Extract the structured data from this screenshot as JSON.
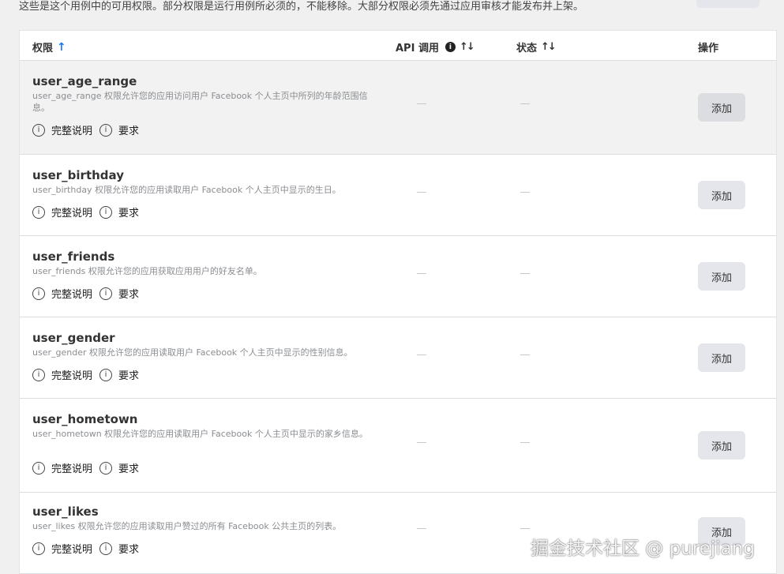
{
  "intro_text": "这些是这个用例中的可用权限。部分权限是运行用例所必须的，不能移除。大部分权限必须先通过应用审核才能发布并上架。",
  "header": {
    "permission": "权限",
    "api_calls": "API 调用",
    "status": "状态",
    "action": "操作"
  },
  "rows": [
    {
      "name": "user_age_range",
      "desc": "user_age_range 权限允许您的应用访问用户 Facebook 个人主页中所列的年龄范围信息。",
      "full_desc": "完整说明",
      "requirements": "要求",
      "api": "—",
      "status": "—",
      "button": "添加"
    },
    {
      "name": "user_birthday",
      "desc": "user_birthday 权限允许您的应用读取用户 Facebook 个人主页中显示的生日。",
      "full_desc": "完整说明",
      "requirements": "要求",
      "api": "—",
      "status": "—",
      "button": "添加"
    },
    {
      "name": "user_friends",
      "desc": "user_friends 权限允许您的应用获取应用用户的好友名单。",
      "full_desc": "完整说明",
      "requirements": "要求",
      "api": "—",
      "status": "—",
      "button": "添加"
    },
    {
      "name": "user_gender",
      "desc": "user_gender 权限允许您的应用读取用户 Facebook 个人主页中显示的性别信息。",
      "full_desc": "完整说明",
      "requirements": "要求",
      "api": "—",
      "status": "—",
      "button": "添加"
    },
    {
      "name": "user_hometown",
      "desc": "user_hometown 权限允许您的应用读取用户 Facebook 个人主页中显示的家乡信息。",
      "full_desc": "完整说明",
      "requirements": "要求",
      "api": "—",
      "status": "—",
      "button": "添加"
    },
    {
      "name": "user_likes",
      "desc": "user_likes 权限允许您的应用读取用户赞过的所有 Facebook 公共主页的列表。",
      "full_desc": "完整说明",
      "requirements": "要求",
      "api": "—",
      "status": "—",
      "button": "添加"
    }
  ],
  "watermark": "掘金技术社区 @ purejiang"
}
